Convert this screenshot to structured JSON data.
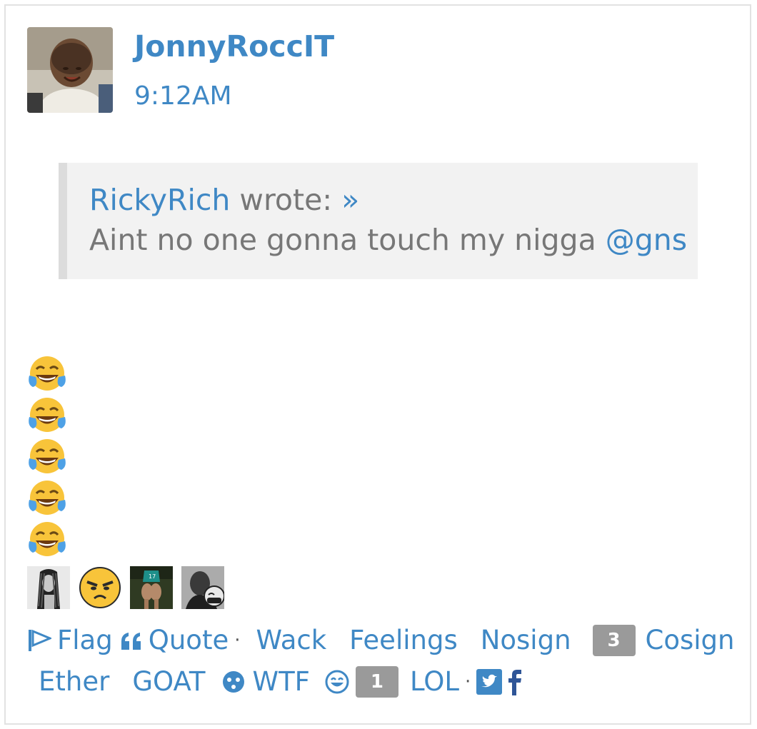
{
  "post": {
    "author": "JonnyRoccIT",
    "time": "9:12AM"
  },
  "quote": {
    "author": "RickyRich",
    "wrote": "wrote:",
    "jump": "»",
    "text": "Aint no one gonna touch my nigga",
    "mention": "@gns"
  },
  "body": {
    "emojis": [
      "face-with-tears-of-joy",
      "face-with-tears-of-joy",
      "face-with-tears-of-joy",
      "face-with-tears-of-joy",
      "face-with-tears-of-joy"
    ]
  },
  "reactions": {
    "reactors": [
      "user-photo-braids",
      "angry-face-emoji",
      "user-photo-jersey-17",
      "user-photo-mlk"
    ]
  },
  "actions": {
    "flag": "Flag",
    "quote": "Quote",
    "wack": "Wack",
    "feelings": "Feelings",
    "nosign": "Nosign",
    "cosign_count": "3",
    "cosign": "Cosign",
    "ether": "Ether",
    "goat": "GOAT",
    "wtf": "WTF",
    "lol_count": "1",
    "lol": "LOL",
    "separator": "·",
    "share_twitter_icon": "twitter-icon",
    "share_facebook_icon": "facebook-icon"
  },
  "colors": {
    "link": "#3f88c5",
    "badge": "#9a9a9a",
    "quote_bg": "#f2f2f2"
  }
}
